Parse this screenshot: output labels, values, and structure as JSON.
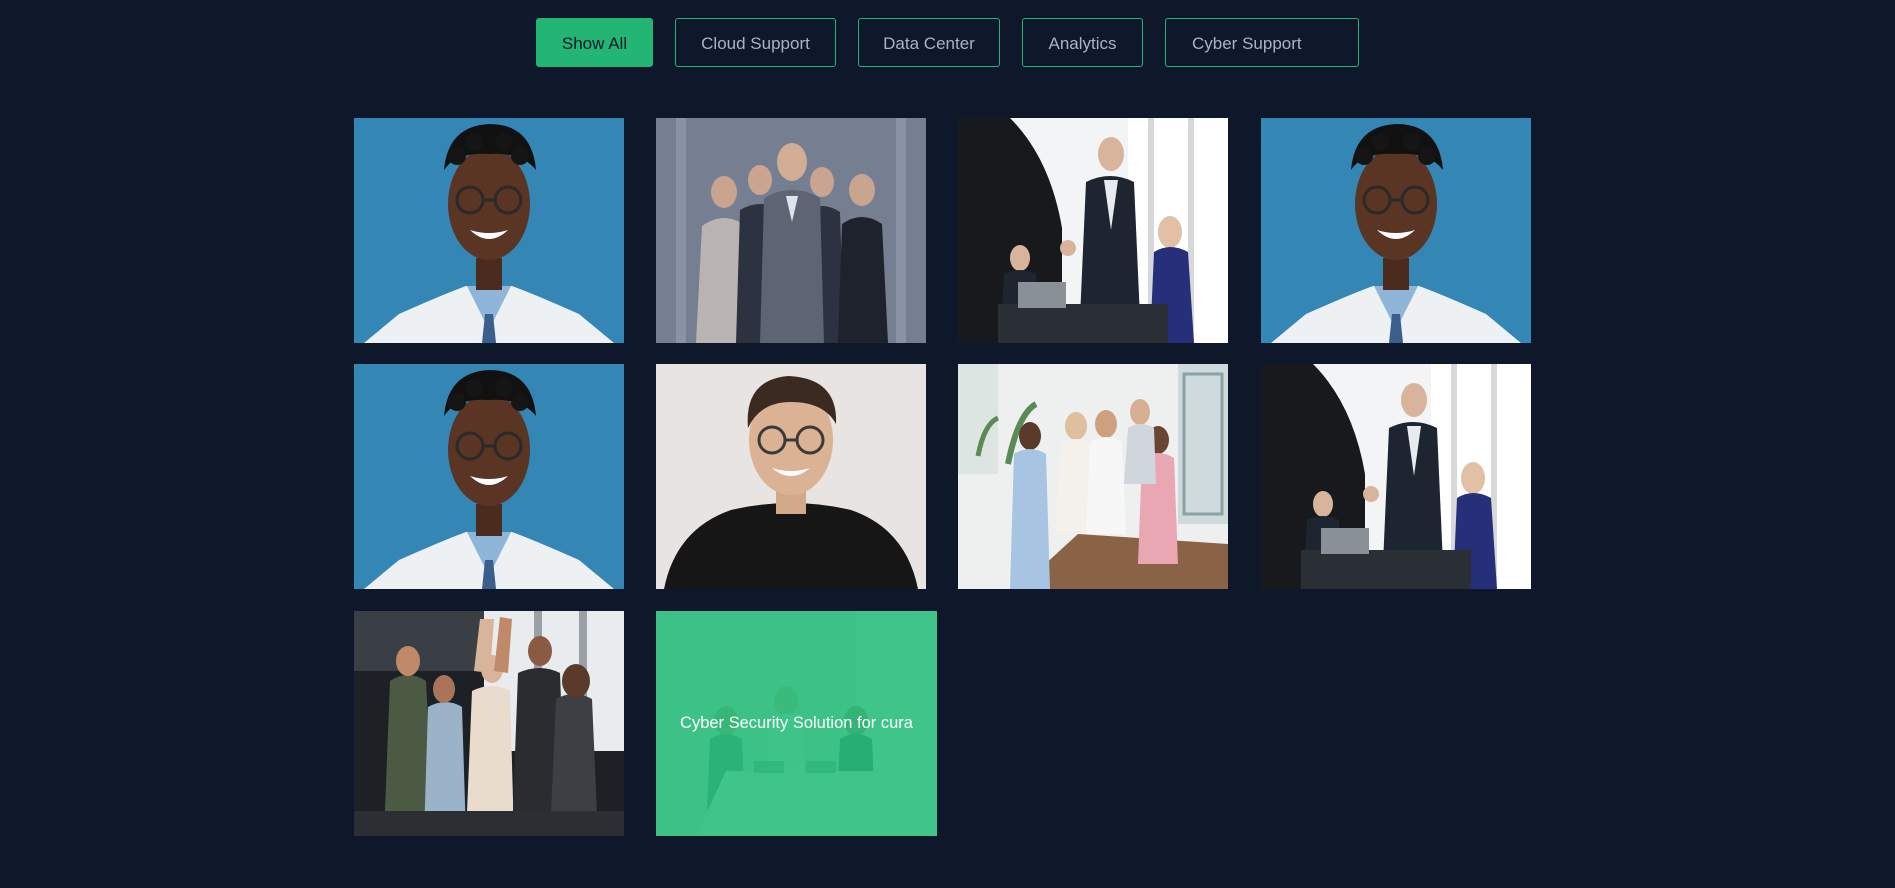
{
  "filters": {
    "buttons": [
      {
        "label": "Show All",
        "active": true
      },
      {
        "label": "Cloud Support",
        "active": false
      },
      {
        "label": "Data Center",
        "active": false
      },
      {
        "label": "Analytics",
        "active": false
      },
      {
        "label": "Cyber Support",
        "active": false
      }
    ]
  },
  "gallery": {
    "items": [
      {
        "photo": "smiling-man-glasses-blue-background"
      },
      {
        "photo": "business-team-group-portrait"
      },
      {
        "photo": "business-handshake-office"
      },
      {
        "photo": "smiling-man-glasses-blue-background"
      },
      {
        "photo": "smiling-man-glasses-blue-background"
      },
      {
        "photo": "young-man-glasses-black-shirt"
      },
      {
        "photo": "team-meeting-bright-office"
      },
      {
        "photo": "business-handshake-office"
      },
      {
        "photo": "team-high-five-office"
      },
      {
        "photo": "team-working-office",
        "caption": "Cyber Security Solution for cura"
      }
    ]
  },
  "colors": {
    "background": "#0f172a",
    "accent": "#22b573",
    "button_text": "#aab3c2"
  }
}
